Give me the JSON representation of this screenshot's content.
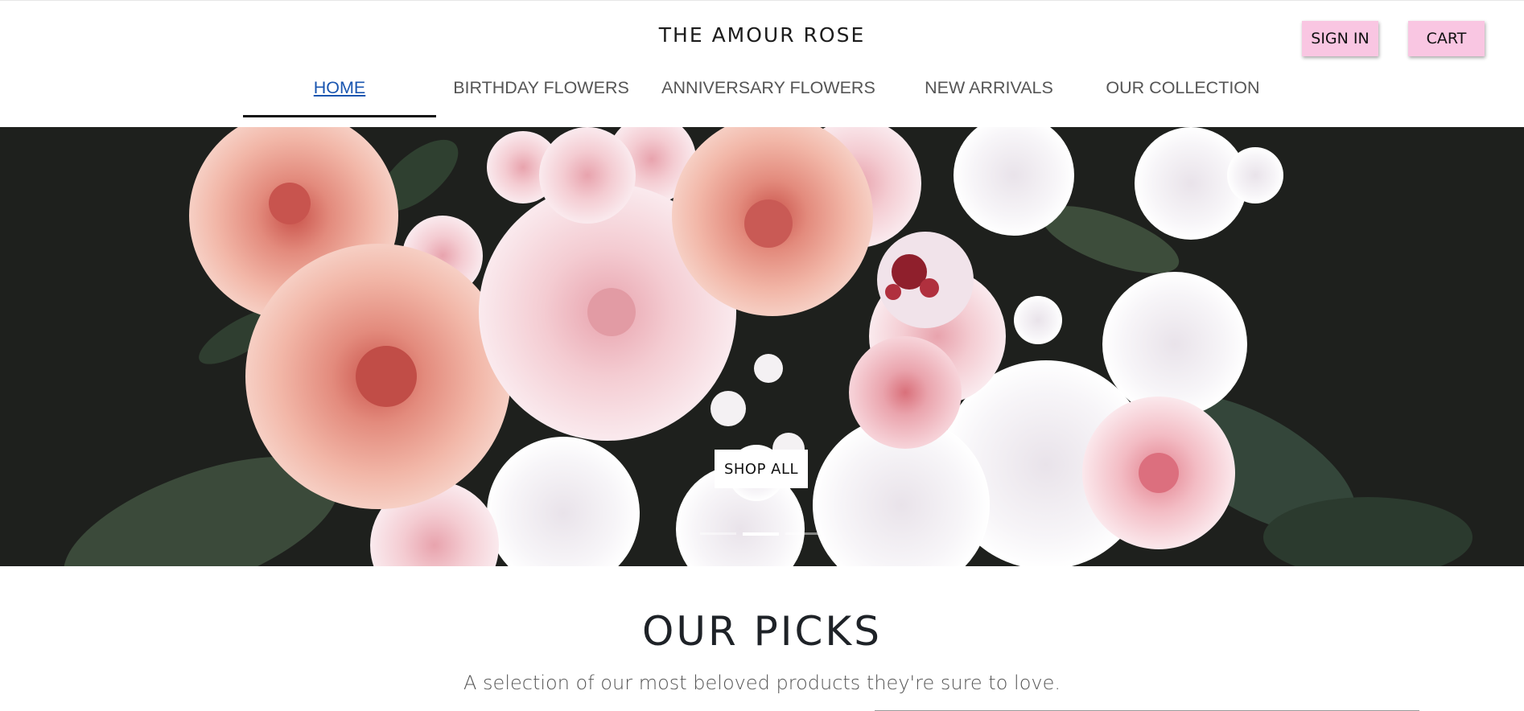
{
  "header": {
    "brand": "THE AMOUR ROSE",
    "sign_in_label": "SIGN IN",
    "cart_label": "CART"
  },
  "nav": {
    "items": [
      {
        "label": "HOME",
        "active": true
      },
      {
        "label": "BIRTHDAY FLOWERS",
        "active": false
      },
      {
        "label": "ANNIVERSARY FLOWERS",
        "active": false
      },
      {
        "label": "NEW ARRIVALS",
        "active": false
      },
      {
        "label": "OUR COLLECTION",
        "active": false
      }
    ]
  },
  "hero": {
    "cta_label": "SHOP ALL",
    "slide_count": 3,
    "active_slide": 2
  },
  "picks": {
    "title": "OUR PICKS",
    "subtitle": "A selection of our most beloved products they're sure to love."
  },
  "colors": {
    "accent_pink": "#f9c6e2",
    "active_link": "#1a56b0",
    "hero_background": "#1d1f1c"
  }
}
